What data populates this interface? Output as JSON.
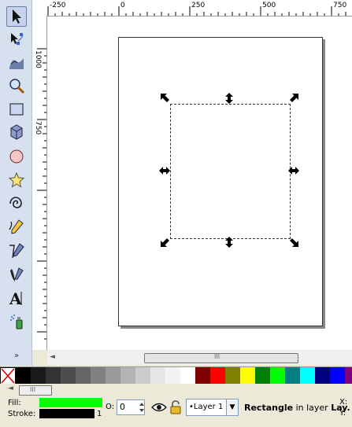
{
  "toolbox": {
    "tools": [
      {
        "name": "selector-tool",
        "icon": "arrow-icon",
        "active": true
      },
      {
        "name": "node-tool",
        "icon": "node-arrow-icon"
      },
      {
        "name": "tweak-tool",
        "icon": "wave-icon"
      },
      {
        "name": "zoom-tool",
        "icon": "magnifier-icon"
      },
      {
        "name": "rectangle-tool",
        "icon": "rectangle-icon"
      },
      {
        "name": "3d-box-tool",
        "icon": "box-icon"
      },
      {
        "name": "ellipse-tool",
        "icon": "circle-icon"
      },
      {
        "name": "star-tool",
        "icon": "star-icon"
      },
      {
        "name": "spiral-tool",
        "icon": "spiral-icon"
      },
      {
        "name": "pencil-tool",
        "icon": "pencil-icon"
      },
      {
        "name": "pen-tool",
        "icon": "pen-icon"
      },
      {
        "name": "calligraphy-tool",
        "icon": "calligraphy-icon"
      },
      {
        "name": "text-tool",
        "icon": "text-icon"
      },
      {
        "name": "spray-tool",
        "icon": "spray-icon"
      }
    ],
    "more": "»"
  },
  "rulers": {
    "h_labels": [
      "-250",
      "0",
      "250",
      "500",
      "750"
    ],
    "v_labels": [
      "1000",
      "750"
    ]
  },
  "scrollbar": {
    "thumb_label": "III"
  },
  "palette": {
    "colors": [
      "#000000",
      "#1a1a1a",
      "#333333",
      "#4d4d4d",
      "#666666",
      "#808080",
      "#999999",
      "#b3b3b3",
      "#cccccc",
      "#e6e6e6",
      "#f2f2f2",
      "#ffffff",
      "#800000",
      "#ff0000",
      "#808000",
      "#ffff00",
      "#008000",
      "#00ff00",
      "#008080",
      "#00ffff",
      "#000080",
      "#0000ff",
      "#800080"
    ]
  },
  "palette_scroll": {
    "thumb_label": "III"
  },
  "status": {
    "fill_label": "Fill:",
    "stroke_label": "Stroke:",
    "fill_color": "#00ff00",
    "stroke_color": "#000000",
    "stroke_width": "1",
    "opacity_label": "O:",
    "opacity_value": "0",
    "layer_name": "•Layer 1",
    "msg_object": "Rectangle",
    "msg_middle": " in layer ",
    "msg_layer": "Lay.",
    "x_label": "X:",
    "y_label": "Y:"
  }
}
